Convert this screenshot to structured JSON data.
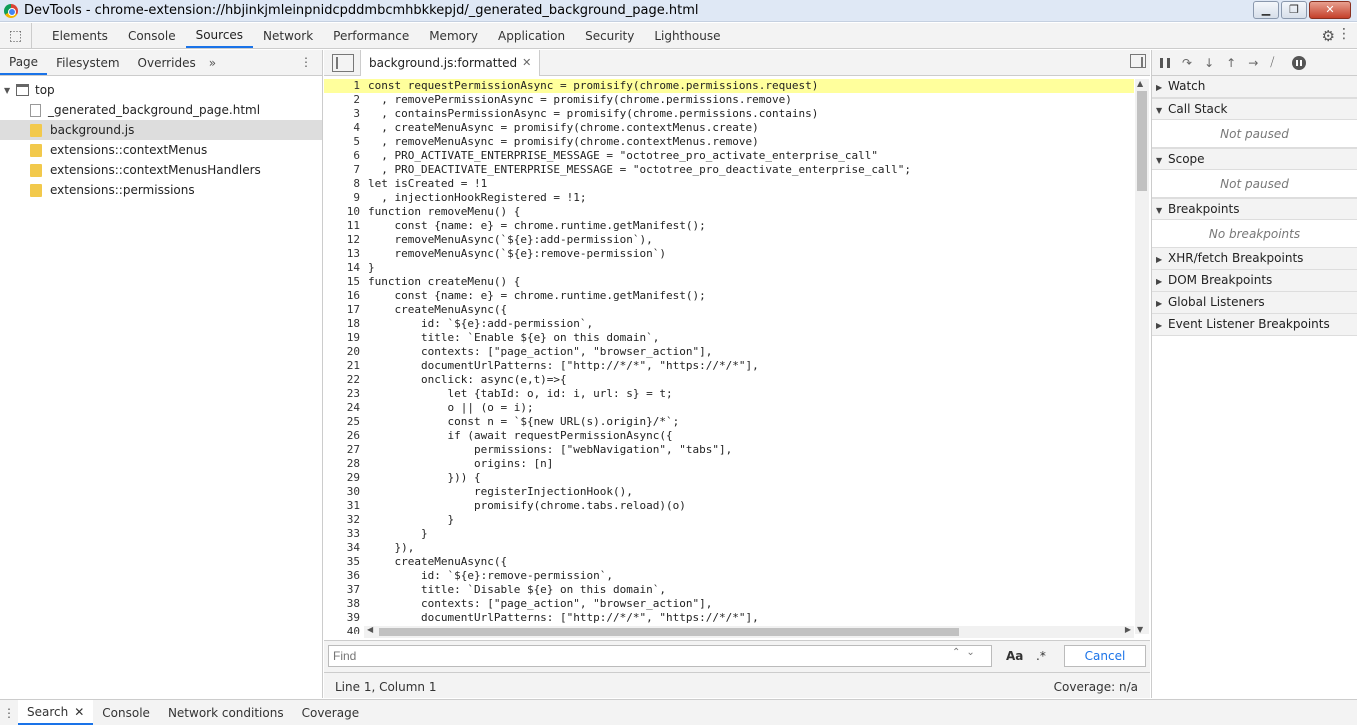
{
  "window": {
    "title": "DevTools - chrome-extension://hbjinkjmleinpnidcpddmbcmhbkkepjd/_generated_background_page.html"
  },
  "main_tabs": [
    {
      "label": "Elements"
    },
    {
      "label": "Console"
    },
    {
      "label": "Sources"
    },
    {
      "label": "Network"
    },
    {
      "label": "Performance"
    },
    {
      "label": "Memory"
    },
    {
      "label": "Application"
    },
    {
      "label": "Security"
    },
    {
      "label": "Lighthouse"
    }
  ],
  "navigator": {
    "tabs": [
      {
        "label": "Page"
      },
      {
        "label": "Filesystem"
      },
      {
        "label": "Overrides"
      }
    ],
    "more": "»",
    "tree": [
      {
        "label": "top"
      },
      {
        "label": "_generated_background_page.html"
      },
      {
        "label": "background.js"
      },
      {
        "label": "extensions::contextMenus"
      },
      {
        "label": "extensions::contextMenusHandlers"
      },
      {
        "label": "extensions::permissions"
      }
    ]
  },
  "editor": {
    "tab_label": "background.js:formatted",
    "lines": [
      "const requestPermissionAsync = promisify(chrome.permissions.request)",
      "  , removePermissionAsync = promisify(chrome.permissions.remove)",
      "  , containsPermissionAsync = promisify(chrome.permissions.contains)",
      "  , createMenuAsync = promisify(chrome.contextMenus.create)",
      "  , removeMenuAsync = promisify(chrome.contextMenus.remove)",
      "  , PRO_ACTIVATE_ENTERPRISE_MESSAGE = \"octotree_pro_activate_enterprise_call\"",
      "  , PRO_DEACTIVATE_ENTERPRISE_MESSAGE = \"octotree_pro_deactivate_enterprise_call\";",
      "let isCreated = !1",
      "  , injectionHookRegistered = !1;",
      "function removeMenu() {",
      "    const {name: e} = chrome.runtime.getManifest();",
      "    removeMenuAsync(`${e}:add-permission`),",
      "    removeMenuAsync(`${e}:remove-permission`)",
      "}",
      "function createMenu() {",
      "    const {name: e} = chrome.runtime.getManifest();",
      "    createMenuAsync({",
      "        id: `${e}:add-permission`,",
      "        title: `Enable ${e} on this domain`,",
      "        contexts: [\"page_action\", \"browser_action\"],",
      "        documentUrlPatterns: [\"http://*/*\", \"https://*/*\"],",
      "        onclick: async(e,t)=>{",
      "            let {tabId: o, id: i, url: s} = t;",
      "            o || (o = i);",
      "            const n = `${new URL(s).origin}/*`;",
      "            if (await requestPermissionAsync({",
      "                permissions: [\"webNavigation\", \"tabs\"],",
      "                origins: [n]",
      "            })) {",
      "                registerInjectionHook(),",
      "                promisify(chrome.tabs.reload)(o)",
      "            }",
      "        }",
      "    }),",
      "    createMenuAsync({",
      "        id: `${e}:remove-permission`,",
      "        title: `Disable ${e} on this domain`,",
      "        contexts: [\"page_action\", \"browser_action\"],",
      "        documentUrlPatterns: [\"http://*/*\", \"https://*/*\"],",
      ""
    ],
    "line_numbers": [
      "1",
      "2",
      "3",
      "4",
      "5",
      "6",
      "7",
      "8",
      "9",
      "10",
      "11",
      "12",
      "13",
      "14",
      "15",
      "16",
      "17",
      "18",
      "19",
      "20",
      "21",
      "22",
      "23",
      "24",
      "25",
      "26",
      "27",
      "28",
      "29",
      "30",
      "31",
      "32",
      "33",
      "34",
      "35",
      "36",
      "37",
      "38",
      "39",
      "40"
    ]
  },
  "find": {
    "placeholder": "Find",
    "case_label": "Aa",
    "regex_label": ".*",
    "cancel_label": "Cancel"
  },
  "status": {
    "position": "Line 1, Column 1",
    "coverage": "Coverage: n/a"
  },
  "debugger": {
    "sections": [
      {
        "label": "Watch",
        "empty": ""
      },
      {
        "label": "Call Stack",
        "empty": "Not paused"
      },
      {
        "label": "Scope",
        "empty": "Not paused"
      },
      {
        "label": "Breakpoints",
        "empty": "No breakpoints"
      },
      {
        "label": "XHR/fetch Breakpoints",
        "empty": ""
      },
      {
        "label": "DOM Breakpoints",
        "empty": ""
      },
      {
        "label": "Global Listeners",
        "empty": ""
      },
      {
        "label": "Event Listener Breakpoints",
        "empty": ""
      }
    ]
  },
  "drawer": {
    "tabs": [
      {
        "label": "Search"
      },
      {
        "label": "Console"
      },
      {
        "label": "Network conditions"
      },
      {
        "label": "Coverage"
      }
    ]
  }
}
